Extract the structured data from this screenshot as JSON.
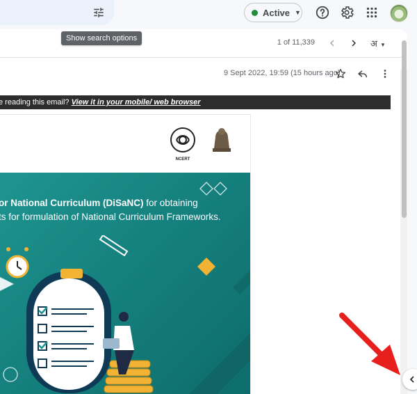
{
  "header": {
    "status_label": "Active",
    "tooltip": "Show search options"
  },
  "toolbar": {
    "pager": "1 of 11,339",
    "language": "अ"
  },
  "message": {
    "date": "9 Sept 2022, 19:59 (15 hours ago)"
  },
  "banner": {
    "prefix": "e reading this email? ",
    "link": "View it in your mobile/ web browser"
  },
  "newsletter": {
    "headline_line1_bold": "or National Curriculum (DiSaNC)",
    "headline_line1_rest": " for obtaining",
    "headline_line2": "ts for formulation of National Curriculum Frameworks.",
    "logo_caption": "NCERT"
  },
  "icons": {
    "tune": "tune-icon",
    "help": "help-icon",
    "settings": "gear-icon",
    "apps": "apps-grid-icon",
    "star": "star-icon",
    "reply": "reply-icon",
    "more": "more-vert-icon",
    "collapse": "chevron-left-icon"
  },
  "colors": {
    "active": "#1e8e3e",
    "teal": "#1e9490",
    "annotation_arrow": "#e8201d"
  }
}
